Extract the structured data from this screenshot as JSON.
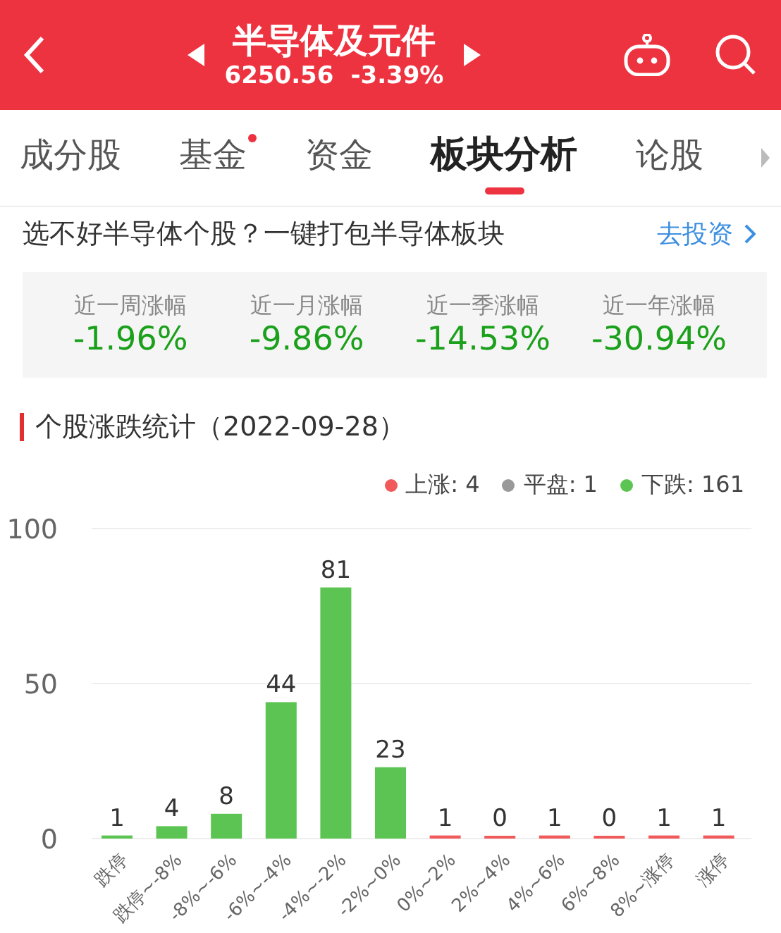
{
  "header": {
    "title": "半导体及元件",
    "price": "6250.56",
    "change": "-3.39%"
  },
  "tabs": [
    {
      "label": "成分股",
      "selected": false,
      "dot": false
    },
    {
      "label": "基金",
      "selected": false,
      "dot": true
    },
    {
      "label": "资金",
      "selected": false,
      "dot": false
    },
    {
      "label": "板块分析",
      "selected": true,
      "dot": false
    },
    {
      "label": "论股",
      "selected": false,
      "dot": false
    }
  ],
  "promo": {
    "text": "选不好半导体个股？一键打包半导体板块",
    "link": "去投资"
  },
  "stats": [
    {
      "label": "近一周涨幅",
      "value": "-1.96%"
    },
    {
      "label": "近一月涨幅",
      "value": "-9.86%"
    },
    {
      "label": "近一季涨幅",
      "value": "-14.53%"
    },
    {
      "label": "近一年涨幅",
      "value": "-30.94%"
    }
  ],
  "section": {
    "title": "个股涨跌统计（2022-09-28）"
  },
  "legend": [
    {
      "label": "上涨: 4",
      "color": "#f05a5a"
    },
    {
      "label": "平盘: 1",
      "color": "#999999"
    },
    {
      "label": "下跌: 161",
      "color": "#5cc452"
    }
  ],
  "chart_data": {
    "type": "bar",
    "categories": [
      "跌停",
      "跌停~-8%",
      "-8%~-6%",
      "-6%~-4%",
      "-4%~-2%",
      "-2%~0%",
      "0%~2%",
      "2%~4%",
      "4%~6%",
      "6%~8%",
      "8%~涨停",
      "涨停"
    ],
    "series": [
      {
        "color": "#5cc452",
        "values": [
          1,
          4,
          8,
          44,
          81,
          23,
          null,
          null,
          null,
          null,
          null,
          null
        ]
      },
      {
        "color": "#f05a5a",
        "values": [
          null,
          null,
          null,
          null,
          null,
          null,
          1,
          0,
          1,
          0,
          1,
          1
        ]
      }
    ],
    "ylim": [
      0,
      100
    ],
    "yticks": [
      0,
      50,
      100
    ],
    "data_labels": true
  }
}
